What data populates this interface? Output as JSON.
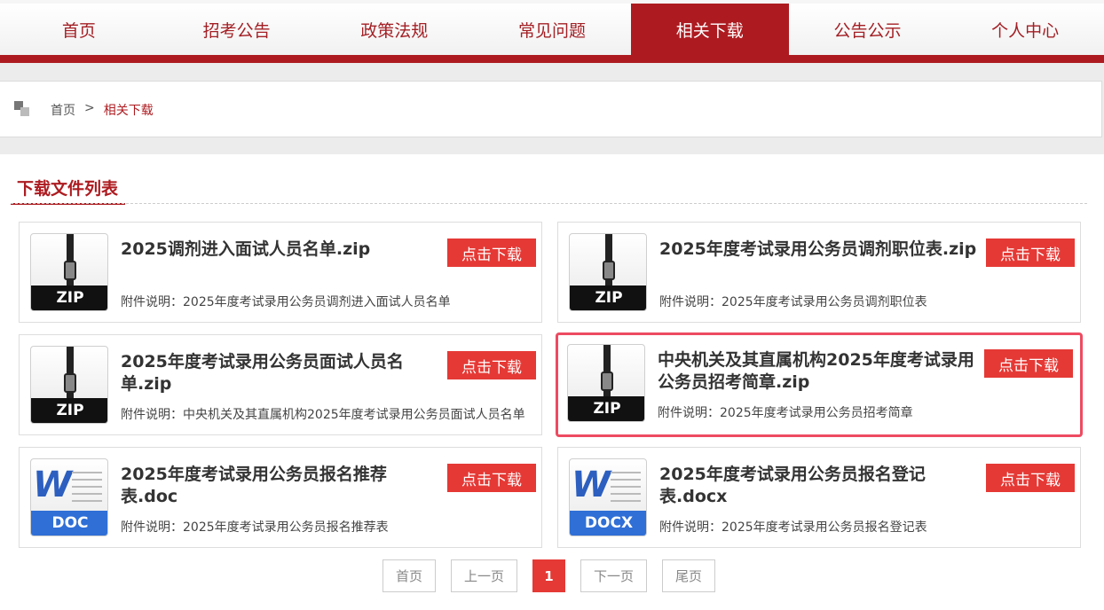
{
  "nav": {
    "items": [
      {
        "label": "首页"
      },
      {
        "label": "招考公告"
      },
      {
        "label": "政策法规"
      },
      {
        "label": "常见问题"
      },
      {
        "label": "相关下载"
      },
      {
        "label": "公告公示"
      },
      {
        "label": "个人中心"
      }
    ],
    "active_index": 4
  },
  "breadcrumb": {
    "home": "首页",
    "separator": ">",
    "current": "相关下载"
  },
  "section": {
    "title": "下载文件列表"
  },
  "download_label": "点击下载",
  "files": [
    {
      "type": "ZIP",
      "title": "2025调剂进入面试人员名单.zip",
      "desc": "附件说明：2025年度考试录用公务员调剂进入面试人员名单"
    },
    {
      "type": "ZIP",
      "title": "2025年度考试录用公务员调剂职位表.zip",
      "desc": "附件说明：2025年度考试录用公务员调剂职位表"
    },
    {
      "type": "ZIP",
      "title": "2025年度考试录用公务员面试人员名单.zip",
      "desc": "附件说明：中央机关及其直属机构2025年度考试录用公务员面试人员名单"
    },
    {
      "type": "ZIP",
      "title": "中央机关及其直属机构2025年度考试录用公务员招考简章.zip",
      "desc": "附件说明：2025年度考试录用公务员招考简章",
      "highlighted": true
    },
    {
      "type": "DOC",
      "title": "2025年度考试录用公务员报名推荐表.doc",
      "desc": "附件说明：2025年度考试录用公务员报名推荐表"
    },
    {
      "type": "DOCX",
      "title": "2025年度考试录用公务员报名登记表.docx",
      "desc": "附件说明：2025年度考试录用公务员报名登记表"
    }
  ],
  "pager": {
    "first": "首页",
    "prev": "上一页",
    "current": "1",
    "next": "下一页",
    "last": "尾页"
  },
  "colors": {
    "brand_red": "#ad1b20",
    "button_red": "#e53935",
    "highlight": "#ed4b61"
  }
}
